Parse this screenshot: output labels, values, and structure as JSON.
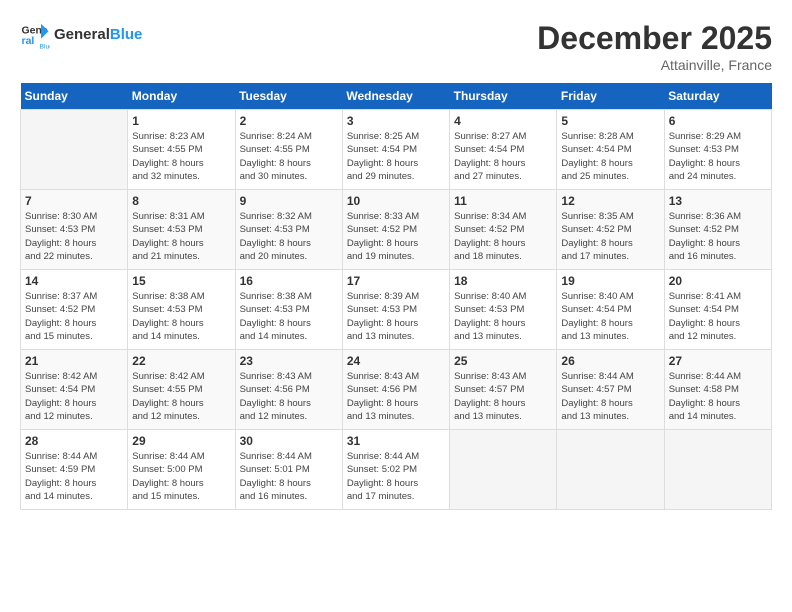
{
  "header": {
    "logo_general": "General",
    "logo_blue": "Blue",
    "title": "December 2025",
    "location": "Attainville, France"
  },
  "calendar": {
    "days_of_week": [
      "Sunday",
      "Monday",
      "Tuesday",
      "Wednesday",
      "Thursday",
      "Friday",
      "Saturday"
    ],
    "weeks": [
      [
        {
          "day": "",
          "info": ""
        },
        {
          "day": "1",
          "info": "Sunrise: 8:23 AM\nSunset: 4:55 PM\nDaylight: 8 hours\nand 32 minutes."
        },
        {
          "day": "2",
          "info": "Sunrise: 8:24 AM\nSunset: 4:55 PM\nDaylight: 8 hours\nand 30 minutes."
        },
        {
          "day": "3",
          "info": "Sunrise: 8:25 AM\nSunset: 4:54 PM\nDaylight: 8 hours\nand 29 minutes."
        },
        {
          "day": "4",
          "info": "Sunrise: 8:27 AM\nSunset: 4:54 PM\nDaylight: 8 hours\nand 27 minutes."
        },
        {
          "day": "5",
          "info": "Sunrise: 8:28 AM\nSunset: 4:54 PM\nDaylight: 8 hours\nand 25 minutes."
        },
        {
          "day": "6",
          "info": "Sunrise: 8:29 AM\nSunset: 4:53 PM\nDaylight: 8 hours\nand 24 minutes."
        }
      ],
      [
        {
          "day": "7",
          "info": "Sunrise: 8:30 AM\nSunset: 4:53 PM\nDaylight: 8 hours\nand 22 minutes."
        },
        {
          "day": "8",
          "info": "Sunrise: 8:31 AM\nSunset: 4:53 PM\nDaylight: 8 hours\nand 21 minutes."
        },
        {
          "day": "9",
          "info": "Sunrise: 8:32 AM\nSunset: 4:53 PM\nDaylight: 8 hours\nand 20 minutes."
        },
        {
          "day": "10",
          "info": "Sunrise: 8:33 AM\nSunset: 4:52 PM\nDaylight: 8 hours\nand 19 minutes."
        },
        {
          "day": "11",
          "info": "Sunrise: 8:34 AM\nSunset: 4:52 PM\nDaylight: 8 hours\nand 18 minutes."
        },
        {
          "day": "12",
          "info": "Sunrise: 8:35 AM\nSunset: 4:52 PM\nDaylight: 8 hours\nand 17 minutes."
        },
        {
          "day": "13",
          "info": "Sunrise: 8:36 AM\nSunset: 4:52 PM\nDaylight: 8 hours\nand 16 minutes."
        }
      ],
      [
        {
          "day": "14",
          "info": "Sunrise: 8:37 AM\nSunset: 4:52 PM\nDaylight: 8 hours\nand 15 minutes."
        },
        {
          "day": "15",
          "info": "Sunrise: 8:38 AM\nSunset: 4:53 PM\nDaylight: 8 hours\nand 14 minutes."
        },
        {
          "day": "16",
          "info": "Sunrise: 8:38 AM\nSunset: 4:53 PM\nDaylight: 8 hours\nand 14 minutes."
        },
        {
          "day": "17",
          "info": "Sunrise: 8:39 AM\nSunset: 4:53 PM\nDaylight: 8 hours\nand 13 minutes."
        },
        {
          "day": "18",
          "info": "Sunrise: 8:40 AM\nSunset: 4:53 PM\nDaylight: 8 hours\nand 13 minutes."
        },
        {
          "day": "19",
          "info": "Sunrise: 8:40 AM\nSunset: 4:54 PM\nDaylight: 8 hours\nand 13 minutes."
        },
        {
          "day": "20",
          "info": "Sunrise: 8:41 AM\nSunset: 4:54 PM\nDaylight: 8 hours\nand 12 minutes."
        }
      ],
      [
        {
          "day": "21",
          "info": "Sunrise: 8:42 AM\nSunset: 4:54 PM\nDaylight: 8 hours\nand 12 minutes."
        },
        {
          "day": "22",
          "info": "Sunrise: 8:42 AM\nSunset: 4:55 PM\nDaylight: 8 hours\nand 12 minutes."
        },
        {
          "day": "23",
          "info": "Sunrise: 8:43 AM\nSunset: 4:56 PM\nDaylight: 8 hours\nand 12 minutes."
        },
        {
          "day": "24",
          "info": "Sunrise: 8:43 AM\nSunset: 4:56 PM\nDaylight: 8 hours\nand 13 minutes."
        },
        {
          "day": "25",
          "info": "Sunrise: 8:43 AM\nSunset: 4:57 PM\nDaylight: 8 hours\nand 13 minutes."
        },
        {
          "day": "26",
          "info": "Sunrise: 8:44 AM\nSunset: 4:57 PM\nDaylight: 8 hours\nand 13 minutes."
        },
        {
          "day": "27",
          "info": "Sunrise: 8:44 AM\nSunset: 4:58 PM\nDaylight: 8 hours\nand 14 minutes."
        }
      ],
      [
        {
          "day": "28",
          "info": "Sunrise: 8:44 AM\nSunset: 4:59 PM\nDaylight: 8 hours\nand 14 minutes."
        },
        {
          "day": "29",
          "info": "Sunrise: 8:44 AM\nSunset: 5:00 PM\nDaylight: 8 hours\nand 15 minutes."
        },
        {
          "day": "30",
          "info": "Sunrise: 8:44 AM\nSunset: 5:01 PM\nDaylight: 8 hours\nand 16 minutes."
        },
        {
          "day": "31",
          "info": "Sunrise: 8:44 AM\nSunset: 5:02 PM\nDaylight: 8 hours\nand 17 minutes."
        },
        {
          "day": "",
          "info": ""
        },
        {
          "day": "",
          "info": ""
        },
        {
          "day": "",
          "info": ""
        }
      ]
    ]
  }
}
